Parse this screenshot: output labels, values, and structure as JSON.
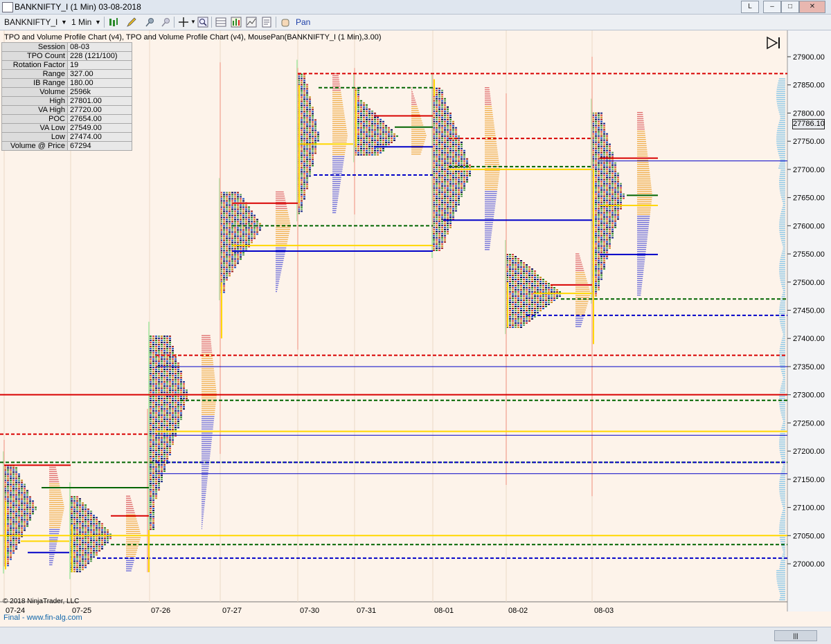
{
  "window": {
    "title": "BANKNIFTY_I (1 Min)  03-08-2018",
    "buttons": [
      "L",
      "–",
      "□",
      "✕"
    ]
  },
  "toolbar": {
    "instrument": "BANKNIFTY_I",
    "interval": "1 Min",
    "dropdown_icon": "chevron-down-icon",
    "pan_label": "Pan",
    "icons": [
      "bar-type-icon",
      "pencil-icon",
      "pin-icon",
      "crosshair-icon",
      "zoom-icon",
      "data-box-icon",
      "indicators-icon",
      "strategies-icon",
      "properties-icon"
    ]
  },
  "chart": {
    "header": "TPO and Volume Profile Chart (v4),  TPO and Volume Profile Chart (v4), MousePan(BANKNIFTY_I (1 Min),3.00)",
    "info": [
      {
        "k": "Session",
        "v": "08-03"
      },
      {
        "k": "TPO Count",
        "v": "228 (121/100)"
      },
      {
        "k": "Rotation Factor",
        "v": "19"
      },
      {
        "k": "Range",
        "v": "327.00"
      },
      {
        "k": "IB Range",
        "v": "180.00"
      },
      {
        "k": "Volume",
        "v": "2596k"
      },
      {
        "k": "High",
        "v": "27801.00"
      },
      {
        "k": "VA High",
        "v": "27720.00"
      },
      {
        "k": "POC",
        "v": "27654.00"
      },
      {
        "k": "VA Low",
        "v": "27549.00"
      },
      {
        "k": "Low",
        "v": "27474.00"
      },
      {
        "k": "Volume @ Price",
        "v": "67294"
      }
    ],
    "current_price": "27786.10",
    "copyright": "© 2018 NinjaTrader, LLC",
    "footer": "Final - www.fin-alg.com",
    "y_ticks": [
      "27900.00",
      "27850.00",
      "27800.00",
      "27750.00",
      "27700.00",
      "27650.00",
      "27600.00",
      "27550.00",
      "27500.00",
      "27450.00",
      "27400.00",
      "27350.00",
      "27300.00",
      "27250.00",
      "27200.00",
      "27150.00",
      "27100.00",
      "27050.00",
      "27000.00"
    ],
    "x_labels": [
      "07-24",
      "07-25",
      "07-26",
      "07-27",
      "07-30",
      "07-31",
      "08-01",
      "08-02",
      "08-03"
    ],
    "colors": {
      "background": "#fdf3ea",
      "poc": "#006400",
      "vah": "#d80000",
      "val": "#0000c8",
      "ib": "#ffd700"
    }
  }
}
